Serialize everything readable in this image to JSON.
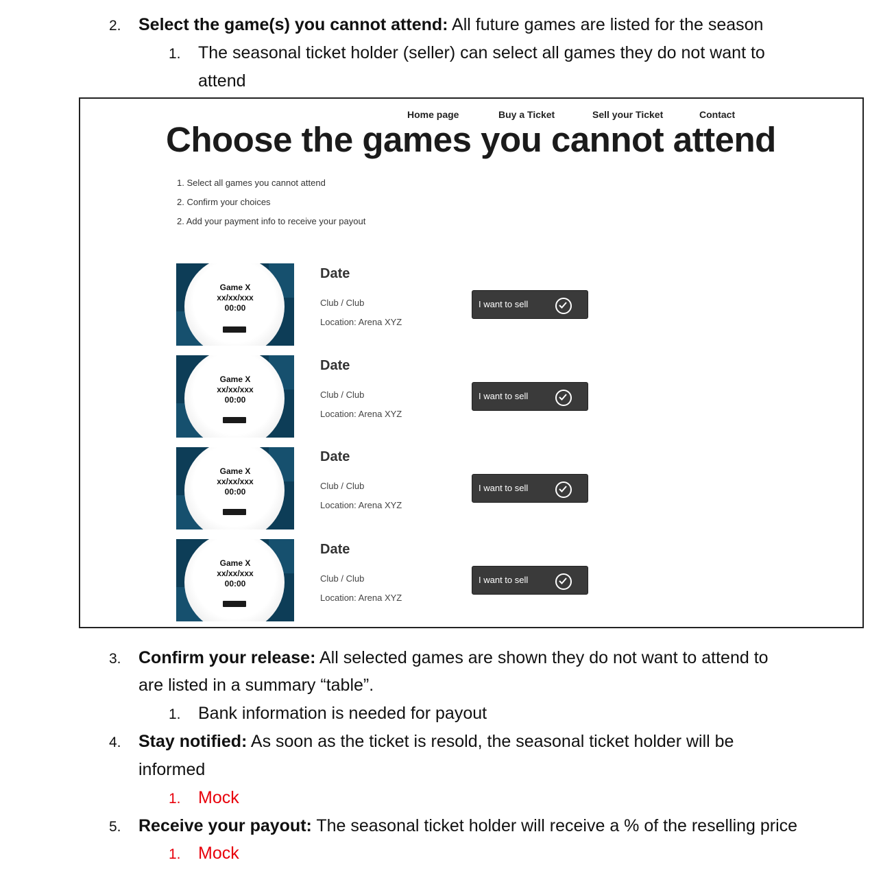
{
  "doc": {
    "item2": {
      "num": "2.",
      "bold": "Select the game(s) you cannot attend:",
      "text": " All future games are listed for the season"
    },
    "item2_1": {
      "num": "1.",
      "line1": "The seasonal ticket holder (seller) can select all games they do not want to",
      "line2": "attend"
    },
    "item3": {
      "num": "3.",
      "bold": "Confirm your release:",
      "text": " All selected games are shown they do not want to attend to",
      "line2": "are listed in a summary “table”."
    },
    "item3_1": {
      "num": "1.",
      "text": "Bank information is needed for payout"
    },
    "item4": {
      "num": "4.",
      "bold": "Stay notified:",
      "text": " As soon as the ticket is resold, the seasonal ticket holder will be",
      "line2": "informed"
    },
    "item4_1": {
      "num": "1.",
      "text": "Mock"
    },
    "item5": {
      "num": "5.",
      "bold": "Receive your payout:",
      "text": " The seasonal ticket holder will receive a % of the reselling price"
    },
    "item5_1": {
      "num": "1.",
      "text": "Mock"
    }
  },
  "mock": {
    "nav": [
      "Home page",
      "Buy a Ticket",
      "Sell your Ticket",
      "Contact"
    ],
    "title": "Choose the games you cannot attend",
    "steps": [
      "1. Select all games you cannot attend",
      "2. Confirm your choices",
      "2. Add your payment info to receive your  payout"
    ],
    "games": [
      {
        "card_title": "Game X",
        "card_date": "xx/xx/xxx",
        "card_time": "00:00",
        "date": "Date",
        "teams": "Club / Club",
        "location": "Location: Arena XYZ",
        "button": "I want to sell"
      },
      {
        "card_title": "Game X",
        "card_date": "xx/xx/xxx",
        "card_time": "00:00",
        "date": "Date",
        "teams": "Club / Club",
        "location": "Location: Arena XYZ",
        "button": "I want to sell"
      },
      {
        "card_title": "Game X",
        "card_date": "xx/xx/xxx",
        "card_time": "00:00",
        "date": "Date",
        "teams": "Club / Club",
        "location": "Location: Arena XYZ",
        "button": "I want to sell"
      },
      {
        "card_title": "Game X",
        "card_date": "xx/xx/xxx",
        "card_time": "00:00",
        "date": "Date",
        "teams": "Club / Club",
        "location": "Location: Arena XYZ",
        "button": "I want to sell"
      }
    ]
  },
  "colors": {
    "mock_red": "#e8000b",
    "button_bg": "#3a3a3a",
    "card_bg": "#0d3d57"
  },
  "icons": {
    "button_icon": "check-circle-icon"
  }
}
